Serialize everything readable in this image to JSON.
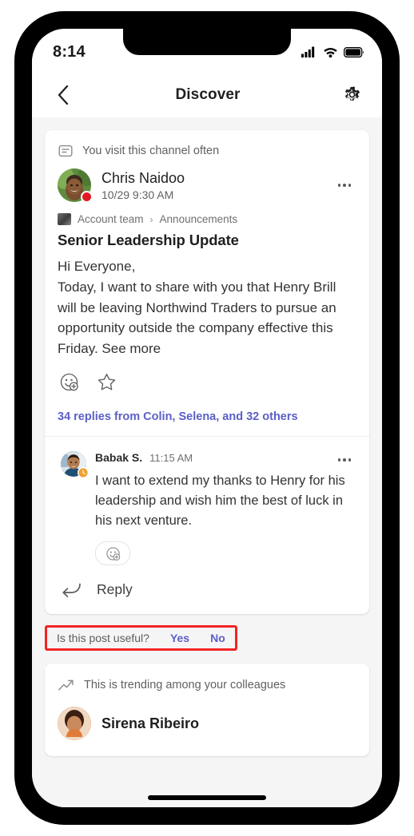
{
  "status_bar": {
    "time": "8:14",
    "icons": [
      "cellular-signal-icon",
      "wifi-icon",
      "battery-icon"
    ]
  },
  "nav": {
    "back_icon": "chevron-left-icon",
    "title": "Discover",
    "settings_icon": "gear-icon"
  },
  "post_card": {
    "hint": {
      "icon": "channel-feed-icon",
      "text": "You visit this channel often"
    },
    "author": {
      "avatar": "chris-naidoo-avatar",
      "presence": "busy",
      "name": "Chris Naidoo",
      "timestamp": "10/29 9:30 AM",
      "more_icon": "more-options-icon"
    },
    "breadcrumb": {
      "team_icon": "team-avatar-icon",
      "team": "Account team",
      "separator": "›",
      "channel": "Announcements"
    },
    "title": "Senior Leadership Update",
    "body": "Hi Everyone,\nToday, I want to share with you that Henry Brill will be leaving Northwind Traders to pursue an opportunity outside the company effective this Friday. See more",
    "reactions": {
      "add_reaction_icon": "add-reaction-icon",
      "save_icon": "star-outline-icon"
    },
    "replies_link": "34 replies from Colin, Selena, and 32 others",
    "reply": {
      "avatar": "babak-s-avatar",
      "presence": "away",
      "name": "Babak S.",
      "timestamp": "11:15 AM",
      "more_icon": "more-options-icon",
      "text": "I want to extend my thanks to Henry for his leadership and wish him the best of luck in his next venture.",
      "add_reaction_icon": "add-reaction-icon"
    },
    "reply_action": {
      "icon": "reply-arrow-icon",
      "label": "Reply"
    }
  },
  "feedback": {
    "question": "Is this post useful?",
    "yes_label": "Yes",
    "no_label": "No",
    "highlight_color": "#f22424",
    "link_color": "#5b5fc7"
  },
  "trending_card": {
    "icon": "trending-up-icon",
    "text": "This is trending among your colleagues",
    "author_avatar": "sirena-ribeiro-avatar",
    "author_name": "Sirena Ribeiro"
  }
}
